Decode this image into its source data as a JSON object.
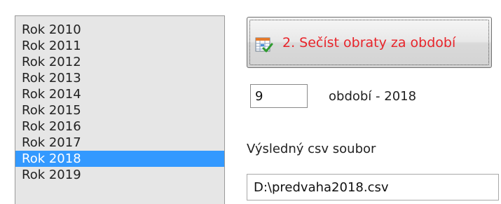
{
  "year_list": {
    "items": [
      {
        "label": "Rok 2010"
      },
      {
        "label": "Rok 2011"
      },
      {
        "label": "Rok 2012"
      },
      {
        "label": "Rok 2013"
      },
      {
        "label": "Rok 2014"
      },
      {
        "label": "Rok 2015"
      },
      {
        "label": "Rok 2016"
      },
      {
        "label": "Rok 2017"
      },
      {
        "label": "Rok 2018"
      },
      {
        "label": "Rok 2019"
      }
    ],
    "selected_label": "Rok 2018",
    "selection_color": "#3399ff",
    "background_color": "#e6e6e6"
  },
  "calc_button": {
    "label": "2. Sečíst obraty za období",
    "label_color": "#e8242a",
    "icon": "spreadsheet-check-icon"
  },
  "period": {
    "value": "9",
    "label": "období - 2018"
  },
  "output": {
    "label": "Výsledný csv soubor",
    "file_value": "D:\\predvaha2018.csv"
  }
}
